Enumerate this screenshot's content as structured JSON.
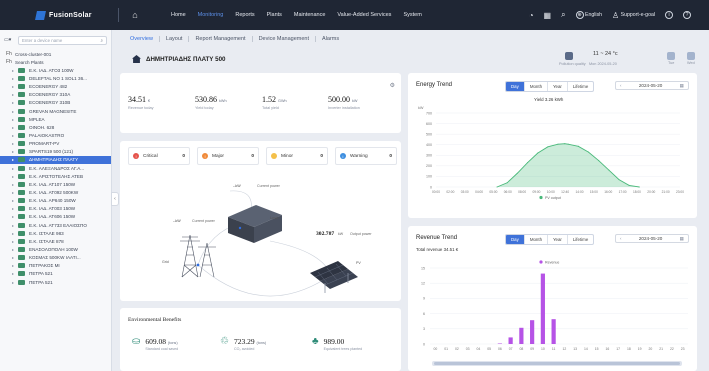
{
  "brand": {
    "name": "FusionSolar"
  },
  "nav": {
    "items": [
      "Home",
      "Monitoring",
      "Reports",
      "Plants",
      "Maintenance",
      "Value-Added Services",
      "System"
    ],
    "active": "Monitoring"
  },
  "tools": {
    "language": "English",
    "support": "Support-e-goal"
  },
  "sidebar": {
    "search_filter": "▾",
    "search_placeholder": "Enter a device name",
    "nodes": [
      {
        "label": "Cross-cluster-001",
        "kind": "top",
        "icon": "Fh"
      },
      {
        "label": "Search Plants",
        "kind": "top",
        "icon": "Fh"
      },
      {
        "label": "Ε.Κ. ΙΑΔ. ΑΤΟ3 100W",
        "kind": "plant"
      },
      {
        "label": "DELEFTAL NO 1 SOL1 36...",
        "kind": "plant"
      },
      {
        "label": "ECOENERGY 482",
        "kind": "plant"
      },
      {
        "label": "ECOENERGY 310A",
        "kind": "plant"
      },
      {
        "label": "ECOENERGY 310B",
        "kind": "plant"
      },
      {
        "label": "GREVAN MAGNESITE",
        "kind": "plant"
      },
      {
        "label": "MPLEA",
        "kind": "plant"
      },
      {
        "label": "OINOH. 628",
        "kind": "plant"
      },
      {
        "label": "PALAIOKASTRO",
        "kind": "plant"
      },
      {
        "label": "PROMART-PV",
        "kind": "plant"
      },
      {
        "label": "SPARTS19 500 (121)",
        "kind": "plant"
      },
      {
        "label": "ΔΗΜΗΤΡΙΑΔΗΣ ΠΛΑΤΥ",
        "kind": "plant",
        "selected": true
      },
      {
        "label": "Ε.Κ. ΑΛΕΞΑΝΔΡΟΣ ΑΓ.Α...",
        "kind": "plant"
      },
      {
        "label": "Ε.Κ. ΑΡΙΣΤΟΤΕΛΗΣ ΑΤΕΒ",
        "kind": "plant"
      },
      {
        "label": "Ε.Κ. ΙΑΔ. ΑΤ107 150W",
        "kind": "plant"
      },
      {
        "label": "Ε.Κ. ΙΑΔ. ΑΤ092 500KW",
        "kind": "plant"
      },
      {
        "label": "Ε.Κ. ΙΑΔ. ΑΡ640 150W",
        "kind": "plant"
      },
      {
        "label": "Ε.Κ. ΙΑΔ. ΑΤ003 150W",
        "kind": "plant"
      },
      {
        "label": "Ε.Κ. ΙΑΔ. ΑΤ606 150W",
        "kind": "plant"
      },
      {
        "label": "Ε.Κ. ΙΑΔ. ΑΤ733 ΕΛΑΙΟΣΠΟ",
        "kind": "plant"
      },
      {
        "label": "Ε.Κ. ΙΣΤΑΛΕ 983",
        "kind": "plant"
      },
      {
        "label": "Ε.Κ. ΙΣΤΑΛΕ 878",
        "kind": "plant"
      },
      {
        "label": "ΕΝΑΣΟΛΟΠΟΛΗ 100W",
        "kind": "plant"
      },
      {
        "label": "ΚΟΣΜΑΣ 500KW ΙΑΑΤΙ...",
        "kind": "plant"
      },
      {
        "label": "ΠΕΤΡΑΚΟΣ ΜΙ",
        "kind": "plant"
      },
      {
        "label": "ΠΕΤΡΑ 521",
        "kind": "plant"
      },
      {
        "label": "ΠΕΤΡΑ 521",
        "kind": "plant"
      }
    ]
  },
  "tabs": [
    "Overview",
    "Layout",
    "Report Management",
    "Device Management",
    "Alarms"
  ],
  "active_tab": "Overview",
  "plant": {
    "name": "ΔΗΜΗΤΡΙΑΔΗΣ ΠΛΑΤΥ 500"
  },
  "weather": {
    "temperature": "11 ~ 24 °c",
    "pollution": "Pollution quality",
    "date": "Mon 2024-05-20",
    "days": [
      "Tue",
      "Wed"
    ],
    "icon": "cloud-sun-icon"
  },
  "kpis": [
    {
      "value": "34.51",
      "unit": "€",
      "label": "Revenue today"
    },
    {
      "value": "530.86",
      "unit": "kWh",
      "label": "Yield today"
    },
    {
      "value": "1.52",
      "unit": "GWh",
      "label": "Total yield"
    },
    {
      "value": "500.00",
      "unit": "kW",
      "label": "Inverter installation"
    }
  ],
  "alarms": [
    {
      "label": "Critical",
      "count": "0",
      "color": "#e5534b",
      "glyph": "!"
    },
    {
      "label": "Major",
      "count": "0",
      "color": "#f08a3a",
      "glyph": "!"
    },
    {
      "label": "Minor",
      "count": "0",
      "color": "#f4c04a",
      "glyph": ""
    },
    {
      "label": "Warning",
      "count": "0",
      "color": "#3f8fe0",
      "glyph": "i"
    }
  ],
  "flow": {
    "grid_label": "Grid",
    "load_label": "Load",
    "pv_label": "PV",
    "current_power_top": "Current power",
    "current_power_left": "Current power",
    "top_value": "--kW",
    "left_value": "--kW",
    "pv_value": "302.787",
    "pv_unit": "kW",
    "pv_text": "Output power"
  },
  "environment": {
    "title": "Environmental Benefits",
    "items": [
      {
        "value": "609.08",
        "unit": "(tons)",
        "label": "Standard coal saved",
        "icon": "coal-icon"
      },
      {
        "value": "723.29",
        "unit": "(tons)",
        "label": "CO₂ avoided",
        "icon": "co2-icon"
      },
      {
        "value": "989.00",
        "unit": "",
        "label": "Equivalent trees planted",
        "icon": "tree-icon"
      }
    ]
  },
  "energy_trend": {
    "title": "Energy Trend",
    "periods": [
      "Day",
      "Month",
      "Year",
      "Lifetime"
    ],
    "active_period": "Day",
    "date": "2024-05-20",
    "yield_text": "Yield 3.26 kWh",
    "legend": "PV output"
  },
  "revenue_trend": {
    "title": "Revenue Trend",
    "periods": [
      "Day",
      "Month",
      "Year",
      "Lifetime"
    ],
    "active_period": "Day",
    "date": "2024-05-20",
    "total_text": "Total revenue 34.51 €",
    "legend": "Revenue"
  },
  "chart_data": [
    {
      "type": "area",
      "title": "Energy Trend",
      "ylabel": "kW",
      "ylim": [
        0,
        700
      ],
      "yticks": [
        0,
        100,
        200,
        300,
        400,
        500,
        600,
        700
      ],
      "x_tick_labels": [
        "00:00",
        "02:00",
        "03:00",
        "04:00",
        "05:00",
        "06:00",
        "08:00",
        "09:00",
        "10:00",
        "12:40",
        "14:00",
        "15:00",
        "16:00",
        "17:00",
        "18:00",
        "20:00",
        "21:00",
        "23:00"
      ],
      "series": [
        {
          "name": "PV output",
          "color": "#49b97a",
          "x": [
            6,
            7,
            8,
            9,
            10,
            11,
            12,
            12.67,
            13,
            14,
            15,
            16,
            17,
            18,
            19,
            20
          ],
          "y": [
            0,
            40,
            130,
            230,
            320,
            380,
            405,
            410,
            405,
            385,
            330,
            250,
            160,
            70,
            15,
            0
          ]
        }
      ],
      "x_range": [
        0,
        24
      ],
      "grid": true,
      "legend": "bottom"
    },
    {
      "type": "bar",
      "title": "Revenue Trend",
      "ylim": [
        0,
        15
      ],
      "yticks": [
        0,
        3,
        6,
        9,
        12,
        15
      ],
      "categories": [
        "00",
        "01",
        "02",
        "03",
        "04",
        "05",
        "06",
        "07",
        "08",
        "09",
        "10",
        "11",
        "12",
        "13",
        "14",
        "15",
        "16",
        "17",
        "18",
        "19",
        "20",
        "21",
        "22",
        "23"
      ],
      "series": [
        {
          "name": "Revenue",
          "color": "#b653e6",
          "values": [
            0,
            0,
            0,
            0,
            0,
            0,
            0.1,
            1.3,
            3.2,
            4.7,
            13.9,
            4.9,
            0,
            0,
            0,
            0,
            0,
            0,
            0,
            0,
            0,
            0,
            0,
            0
          ]
        }
      ],
      "grid": true,
      "legend": "top"
    }
  ]
}
